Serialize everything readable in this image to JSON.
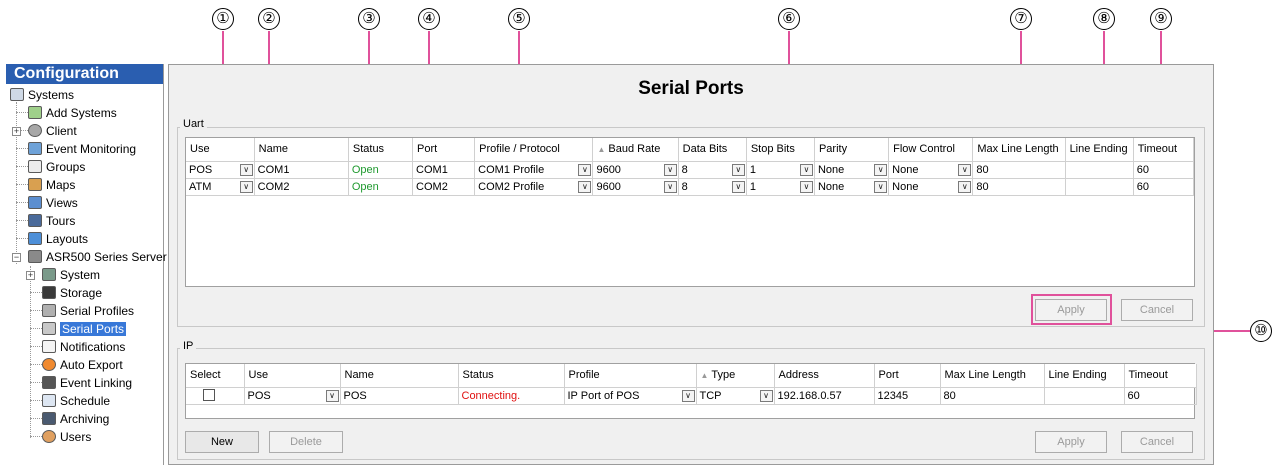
{
  "callouts": [
    "①",
    "②",
    "③",
    "④",
    "⑤",
    "⑥",
    "⑦",
    "⑧",
    "⑨",
    "⑩"
  ],
  "sidebar": {
    "title": "Configuration",
    "items": [
      {
        "label": "Systems",
        "icon": "systems-icon"
      },
      {
        "label": "Add Systems",
        "icon": "add-systems-icon"
      },
      {
        "label": "Client",
        "icon": "gear-icon"
      },
      {
        "label": "Event Monitoring",
        "icon": "event-monitoring-icon"
      },
      {
        "label": "Groups",
        "icon": "groups-icon"
      },
      {
        "label": "Maps",
        "icon": "maps-icon"
      },
      {
        "label": "Views",
        "icon": "views-icon"
      },
      {
        "label": "Tours",
        "icon": "tours-icon"
      },
      {
        "label": "Layouts",
        "icon": "layouts-icon"
      },
      {
        "label": "ASR500 Series Server",
        "icon": "server-icon"
      },
      {
        "label": "System",
        "icon": "system-icon"
      },
      {
        "label": "Storage",
        "icon": "storage-icon"
      },
      {
        "label": "Serial Profiles",
        "icon": "serial-profiles-icon"
      },
      {
        "label": "Serial Ports",
        "icon": "serial-ports-icon"
      },
      {
        "label": "Notifications",
        "icon": "envelope-icon"
      },
      {
        "label": "Auto Export",
        "icon": "auto-export-icon"
      },
      {
        "label": "Event Linking",
        "icon": "link-icon"
      },
      {
        "label": "Schedule",
        "icon": "schedule-icon"
      },
      {
        "label": "Archiving",
        "icon": "archiving-icon"
      },
      {
        "label": "Users",
        "icon": "users-icon"
      }
    ]
  },
  "main": {
    "title": "Serial Ports",
    "uart": {
      "label": "Uart",
      "columns": [
        "Use",
        "Name",
        "Status",
        "Port",
        "Profile / Protocol",
        "Baud Rate",
        "Data Bits",
        "Stop Bits",
        "Parity",
        "Flow Control",
        "Max Line Length",
        "Line Ending",
        "Timeout"
      ],
      "rows": [
        {
          "use": "POS",
          "name": "COM1",
          "status": "Open",
          "port": "COM1",
          "profile": "COM1 Profile",
          "baud": "9600",
          "databits": "8",
          "stopbits": "1",
          "parity": "None",
          "flow": "None",
          "maxlen": "80",
          "ending": "",
          "timeout": "60"
        },
        {
          "use": "ATM",
          "name": "COM2",
          "status": "Open",
          "port": "COM2",
          "profile": "COM2 Profile",
          "baud": "9600",
          "databits": "8",
          "stopbits": "1",
          "parity": "None",
          "flow": "None",
          "maxlen": "80",
          "ending": "",
          "timeout": "60"
        }
      ],
      "apply_label": "Apply",
      "cancel_label": "Cancel"
    },
    "ip": {
      "label": "IP",
      "columns": [
        "Select",
        "Use",
        "Name",
        "Status",
        "Profile",
        "Type",
        "Address",
        "Port",
        "Max Line Length",
        "Line Ending",
        "Timeout"
      ],
      "rows": [
        {
          "use": "POS",
          "name": "POS",
          "status": "Connecting.",
          "profile": "IP Port of POS",
          "type": "TCP",
          "address": "192.168.0.57",
          "port": "12345",
          "maxlen": "80",
          "ending": "",
          "timeout": "60"
        }
      ],
      "new_label": "New",
      "delete_label": "Delete",
      "apply_label": "Apply",
      "cancel_label": "Cancel"
    }
  },
  "colors": {
    "callout_line": "#e0519b",
    "open_status": "#1f9a2f",
    "connecting_status": "#e01010",
    "selection": "#3878d8",
    "sidebar_header": "#2a5eb0"
  }
}
